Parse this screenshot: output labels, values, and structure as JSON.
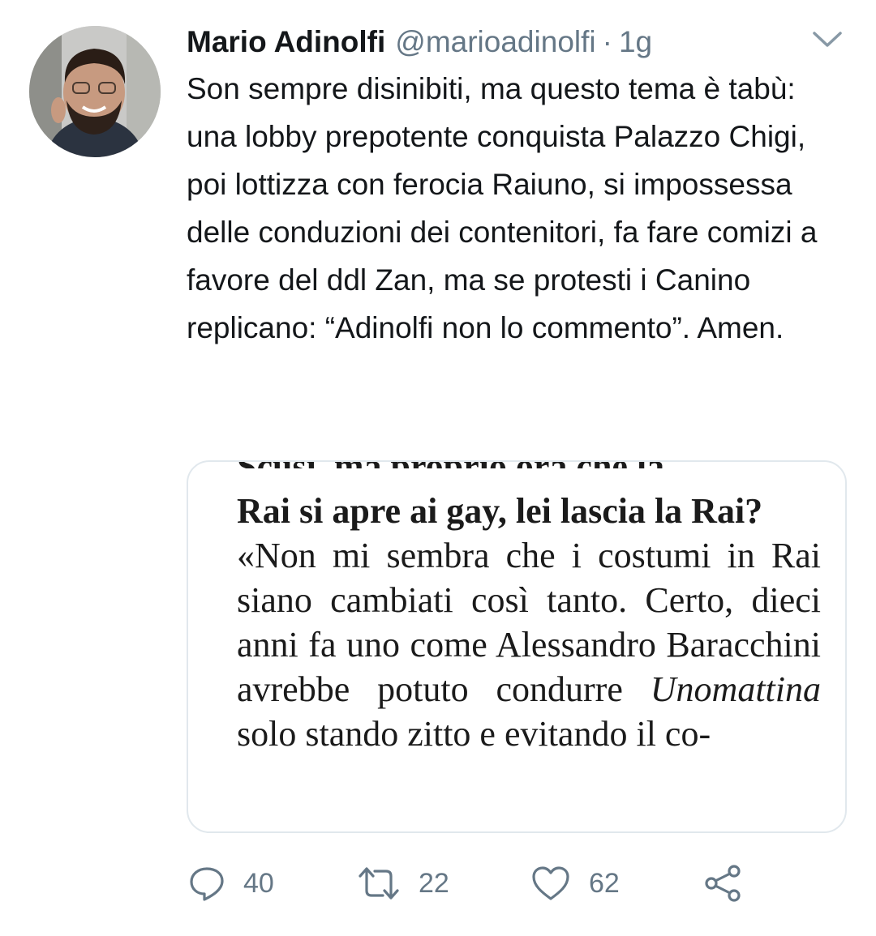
{
  "tweet": {
    "display_name": "Mario Adinolfi",
    "handle": "@marioadinolfi",
    "separator": "·",
    "time": "1g",
    "avatar_icon": "user-avatar",
    "menu_icon": "chevron-down-icon",
    "text": "Son sempre disinibiti, ma questo tema è tabù: una lobby prepotente conquista Palazzo Chigi, poi lottizza con ferocia Raiuno, si impossessa delle conduzioni dei contenitori, fa fare comizi a favore del ddl Zan, ma se protesti i Canino replicano: “Adinolfi non lo commento”. Amen."
  },
  "media": {
    "cut_line": "Scusi, ma proprio ora che la",
    "question": "Rai si apre ai gay, lei lascia la Rai?",
    "answer_before": "«Non mi sembra che i costumi in Rai siano cambiati così tanto. Certo, dieci anni fa uno come Alessandro Baracchini avrebbe potuto condurre ",
    "answer_italic": "Unomattina",
    "answer_after": " solo stando zitto e evitando il co-"
  },
  "actions": {
    "reply_count": "40",
    "retweet_count": "22",
    "like_count": "62",
    "icons": [
      "reply-icon",
      "retweet-icon",
      "like-icon",
      "share-icon"
    ],
    "icon_color": "#657786"
  },
  "colors": {
    "text": "#14171a",
    "secondary": "#657786",
    "border": "#e1e8ed"
  }
}
